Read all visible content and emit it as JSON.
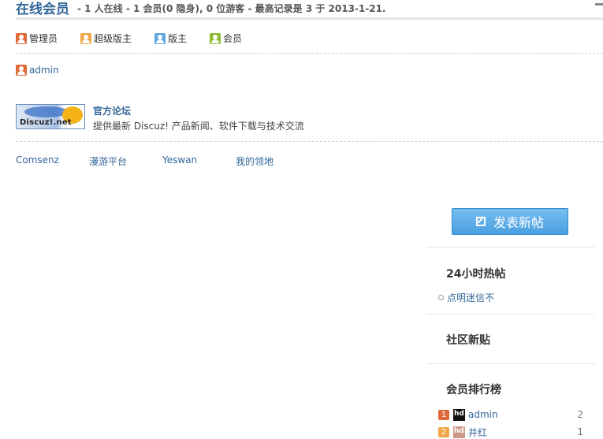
{
  "online": {
    "title": "在线会员",
    "stats": "- 1 人在线 - 1 会员(0 隐身), 0 位游客 - 最高记录是 3 于 2013-1-21."
  },
  "legend": [
    {
      "label": "管理员",
      "icon": "admin-user-icon",
      "color": "#e0693a"
    },
    {
      "label": "超级版主",
      "icon": "super-moderator-user-icon",
      "color": "#f0a848"
    },
    {
      "label": "版主",
      "icon": "moderator-user-icon",
      "color": "#5aa6e0"
    },
    {
      "label": "会员",
      "icon": "member-user-icon",
      "color": "#8bbd2e"
    }
  ],
  "online_members": [
    {
      "name": "admin",
      "icon": "admin-user-icon"
    }
  ],
  "friend_forum": {
    "logo_text": "Discuz!.net",
    "name": "官方论坛",
    "description": "提供最新 Discuz! 产品新闻、软件下载与技术交流"
  },
  "links": [
    "Comsenz",
    "漫游平台",
    "Yeswan",
    "我的领地"
  ],
  "sidebar": {
    "post_button_label": "发表新帖",
    "hot_title": "24小时热帖",
    "hot_items": [
      "点明迷信不"
    ],
    "new_title": "社区新贴",
    "rank_title": "会员排行榜",
    "rank": [
      {
        "num": "1",
        "name": "admin",
        "count": "2",
        "color": "#e0693a"
      },
      {
        "num": "2",
        "name": "井红",
        "count": "1",
        "color": "#f0a848"
      }
    ]
  },
  "colors": {
    "link": "#336699",
    "button": "#4a9fe0"
  }
}
